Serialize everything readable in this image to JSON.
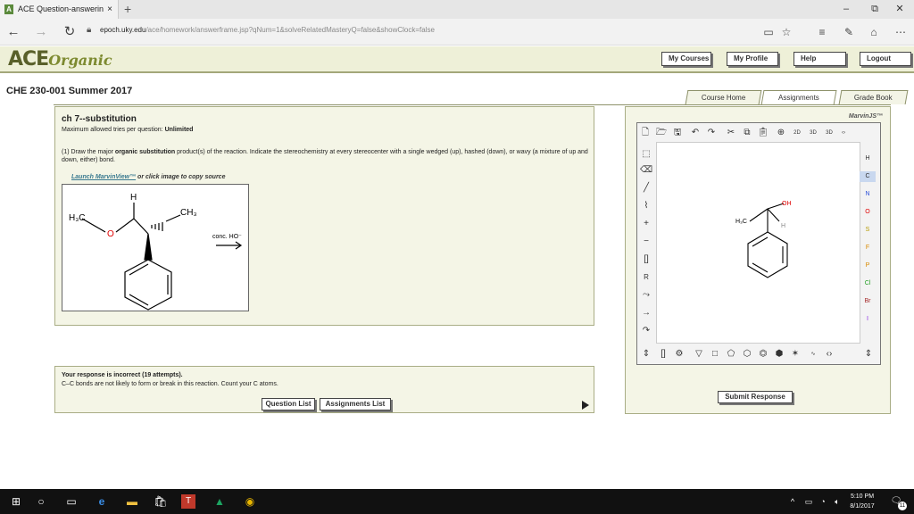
{
  "browser": {
    "tab_title": "ACE Question-answerin",
    "tab_close": "×",
    "new_tab": "+",
    "win_min": "–",
    "win_max": "⧉",
    "win_close": "✕",
    "url_domain": "epoch.uky.edu",
    "url_rest": "/ace/homework/answerframe.jsp?qNum=1&solveRelatedMasteryQ=false&showClock=false"
  },
  "header": {
    "logo_main": "ACE",
    "logo_script": "Organic",
    "buttons": [
      "My Courses",
      "My Profile",
      "Help",
      "Logout"
    ]
  },
  "course_title": "CHE 230-001 Summer 2017",
  "nav_tabs": [
    "Course Home",
    "Assignments",
    "Grade Book"
  ],
  "question": {
    "title": "ch 7--substitution",
    "max_label": "Maximum allowed tries per question:",
    "max_value": "Unlimited",
    "text_prefix": "(1) Draw the major",
    "text_bold": "organic substitution",
    "text_suffix": "product(s) of the reaction. Indicate the stereochemistry at every stereocenter with a single wedged (up), hashed (down), or wavy (a mixture of up and down, either) bond.",
    "launch_link": "Launch MarvinView™",
    "launch_suffix": "or click image to copy source",
    "reagent": "conc. HO⁻"
  },
  "response": {
    "status": "Your response is incorrect (19 attempts).",
    "hint": "C–C bonds are not likely to form or break in this reaction. Count your C atoms.",
    "question_list": "Question List",
    "assignments_list": "Assignments List"
  },
  "marvin": {
    "label": "MarvinJS™",
    "elements": [
      "H",
      "C",
      "N",
      "O",
      "S",
      "F",
      "P",
      "Cl",
      "Br",
      "I"
    ],
    "selected_element": "C",
    "submit": "Submit Response"
  },
  "taskbar": {
    "time": "5:10 PM",
    "date": "8/1/2017",
    "notify_count": "11"
  }
}
